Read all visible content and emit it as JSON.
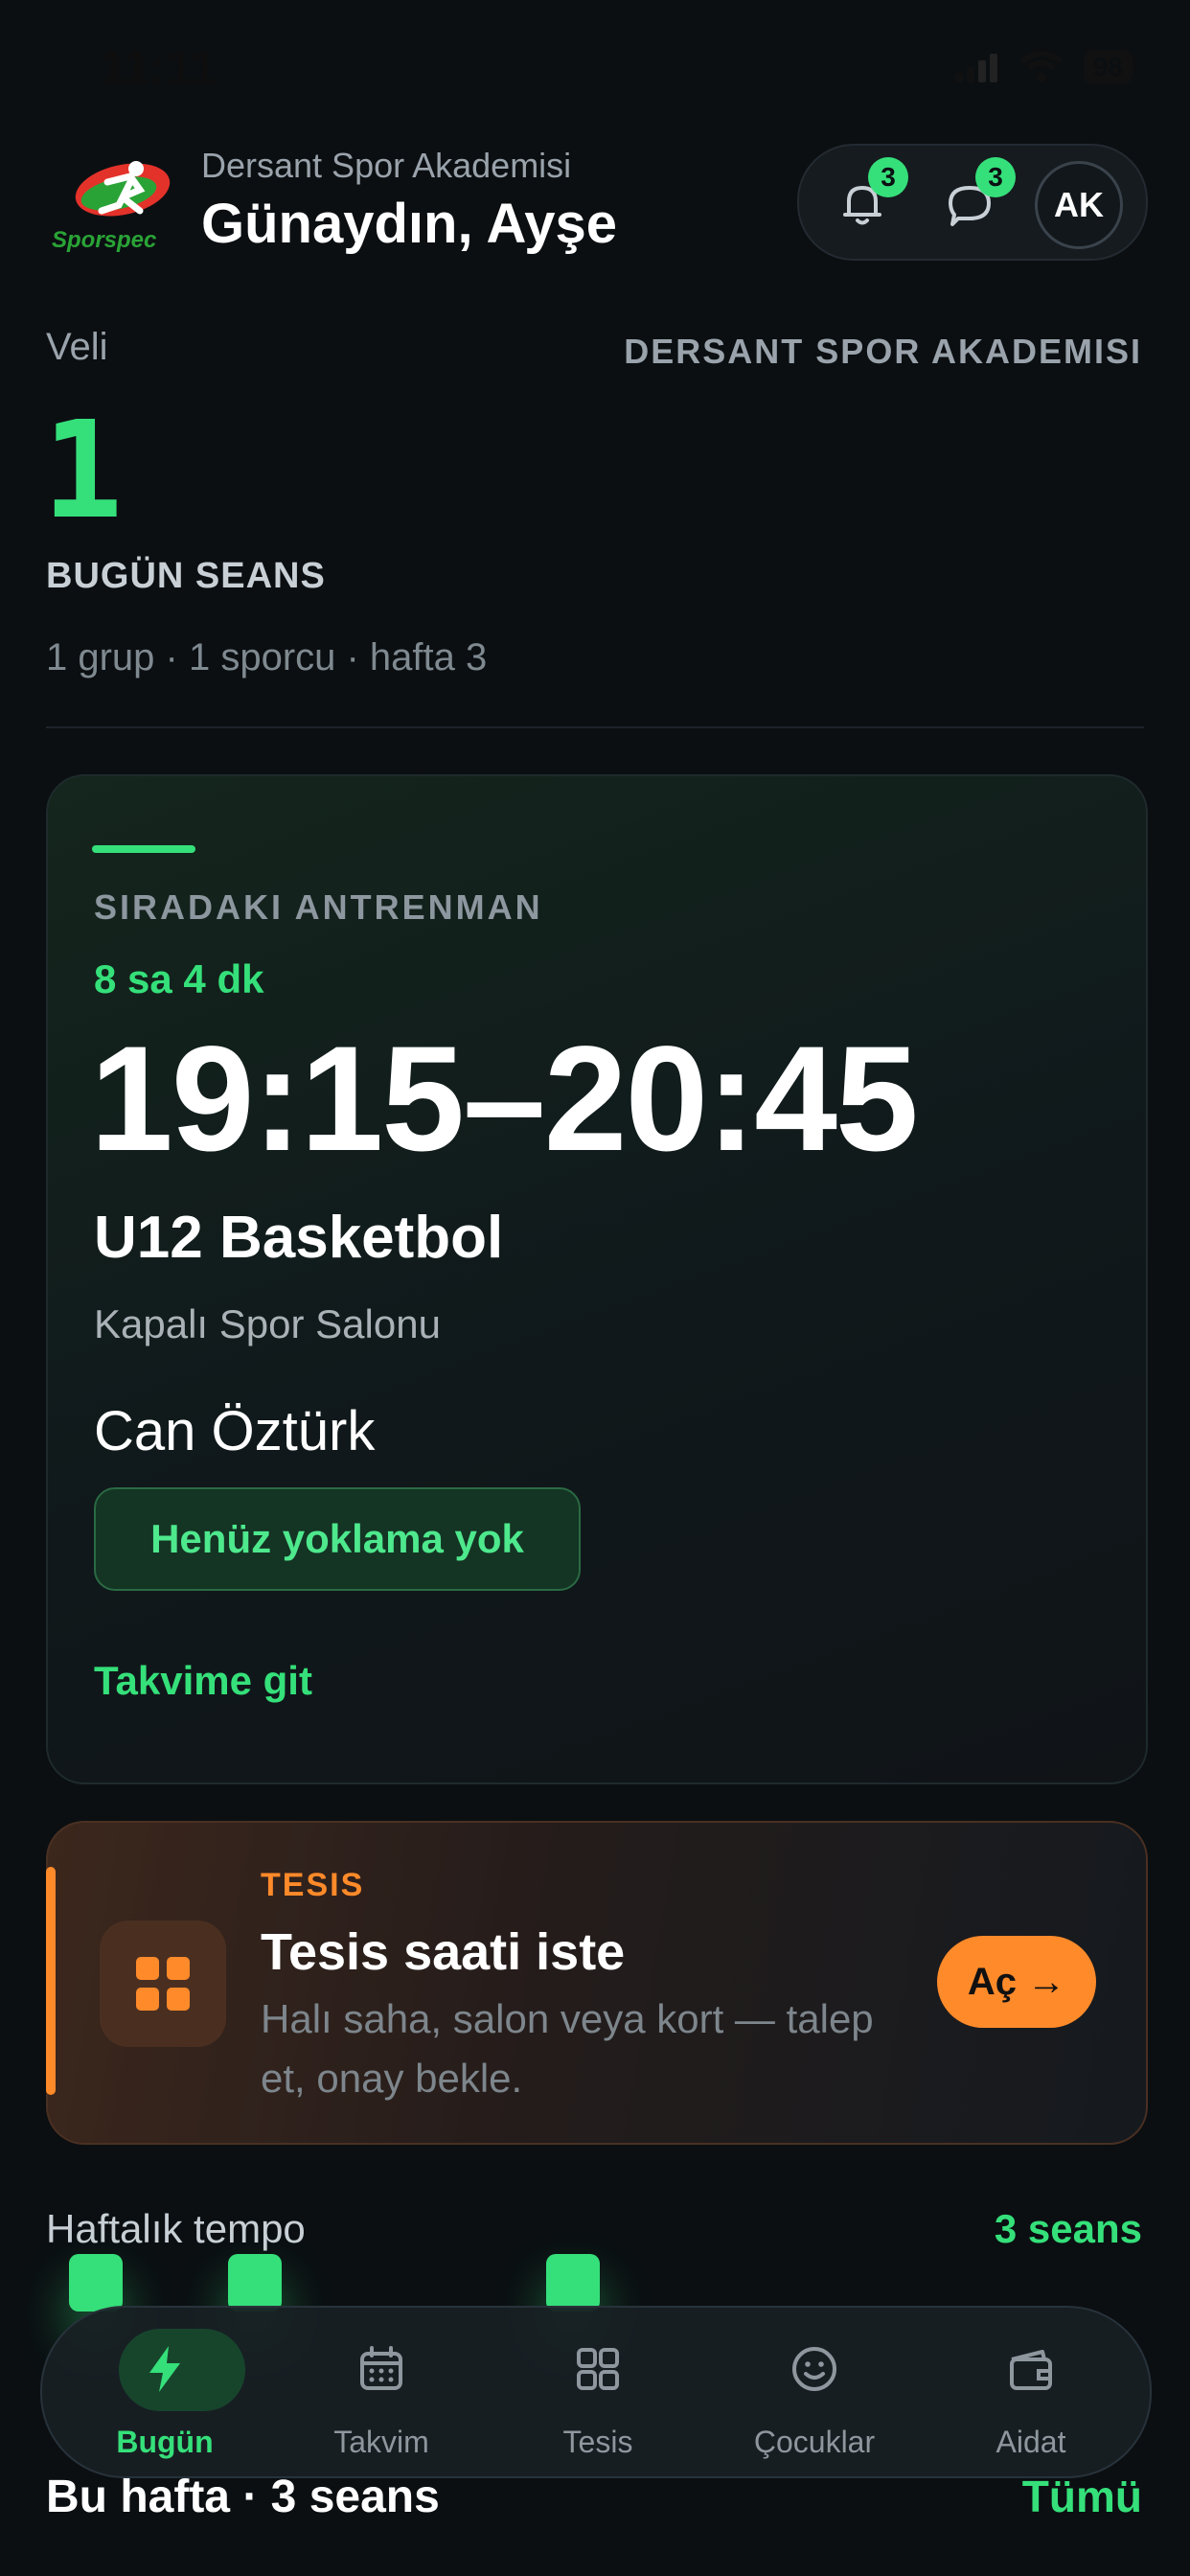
{
  "status_bar": {
    "time": "11:11",
    "battery": "98"
  },
  "header": {
    "logo_text": "Sporspec",
    "academy_name": "Dersant Spor Akademisi",
    "greeting": "Günaydın, Ayşe",
    "notifications_count": "3",
    "messages_count": "3",
    "avatar_initials": "AK"
  },
  "overview": {
    "role": "Veli",
    "academy_upper": "DERSANT SPOR AKADEMISI",
    "today_count": "1",
    "today_label": "BUGÜN SEANS",
    "summary": "1 grup · 1 sporcu · hafta 3"
  },
  "next_training": {
    "eyebrow": "SIRADAKI ANTRENMAN",
    "countdown": "8 sa 4 dk",
    "time_range": "19:15–20:45",
    "group": "U12 Basketbol",
    "venue": "Kapalı Spor Salonu",
    "child": "Can Öztürk",
    "attendance_status": "Henüz yoklama yok",
    "calendar_link": "Takvime git"
  },
  "facility": {
    "eyebrow": "TESIS",
    "title": "Tesis saati iste",
    "description": "Halı saha, salon veya kort — talep et, onay bekle.",
    "button_label": "Aç →"
  },
  "weekly_tempo": {
    "title": "Haftalık tempo",
    "count": "3 seans",
    "days_with_sessions": [
      0,
      1,
      3
    ]
  },
  "colors": {
    "accent_green": "#35e07a",
    "accent_orange": "#ff8a2a",
    "background": "#0b0f12"
  },
  "nav": {
    "items": [
      {
        "label": "Bugün",
        "icon": "bolt-icon",
        "active": true
      },
      {
        "label": "Takvim",
        "icon": "calendar-icon",
        "active": false
      },
      {
        "label": "Tesis",
        "icon": "grid-icon",
        "active": false
      },
      {
        "label": "Çocuklar",
        "icon": "smiley-icon",
        "active": false
      },
      {
        "label": "Aidat",
        "icon": "wallet-icon",
        "active": false
      }
    ]
  },
  "this_week": {
    "title": "Bu hafta · 3 seans",
    "all_link": "Tümü"
  }
}
